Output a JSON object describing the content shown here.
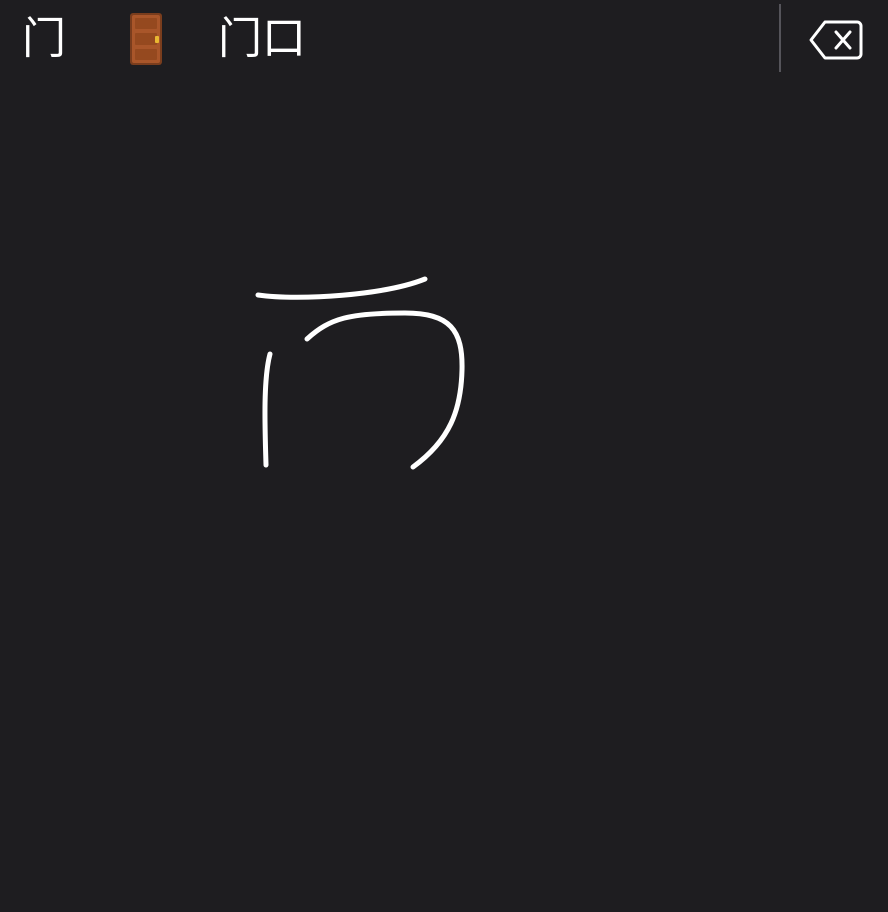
{
  "candidates": [
    {
      "type": "text",
      "label": "门"
    },
    {
      "type": "emoji",
      "icon": "door-emoji-icon"
    },
    {
      "type": "text",
      "label": "门口"
    }
  ],
  "delete_key": {
    "icon": "backspace-icon"
  },
  "drawing": {
    "stroke_color": "#ffffff",
    "background": "#1e1d20"
  }
}
